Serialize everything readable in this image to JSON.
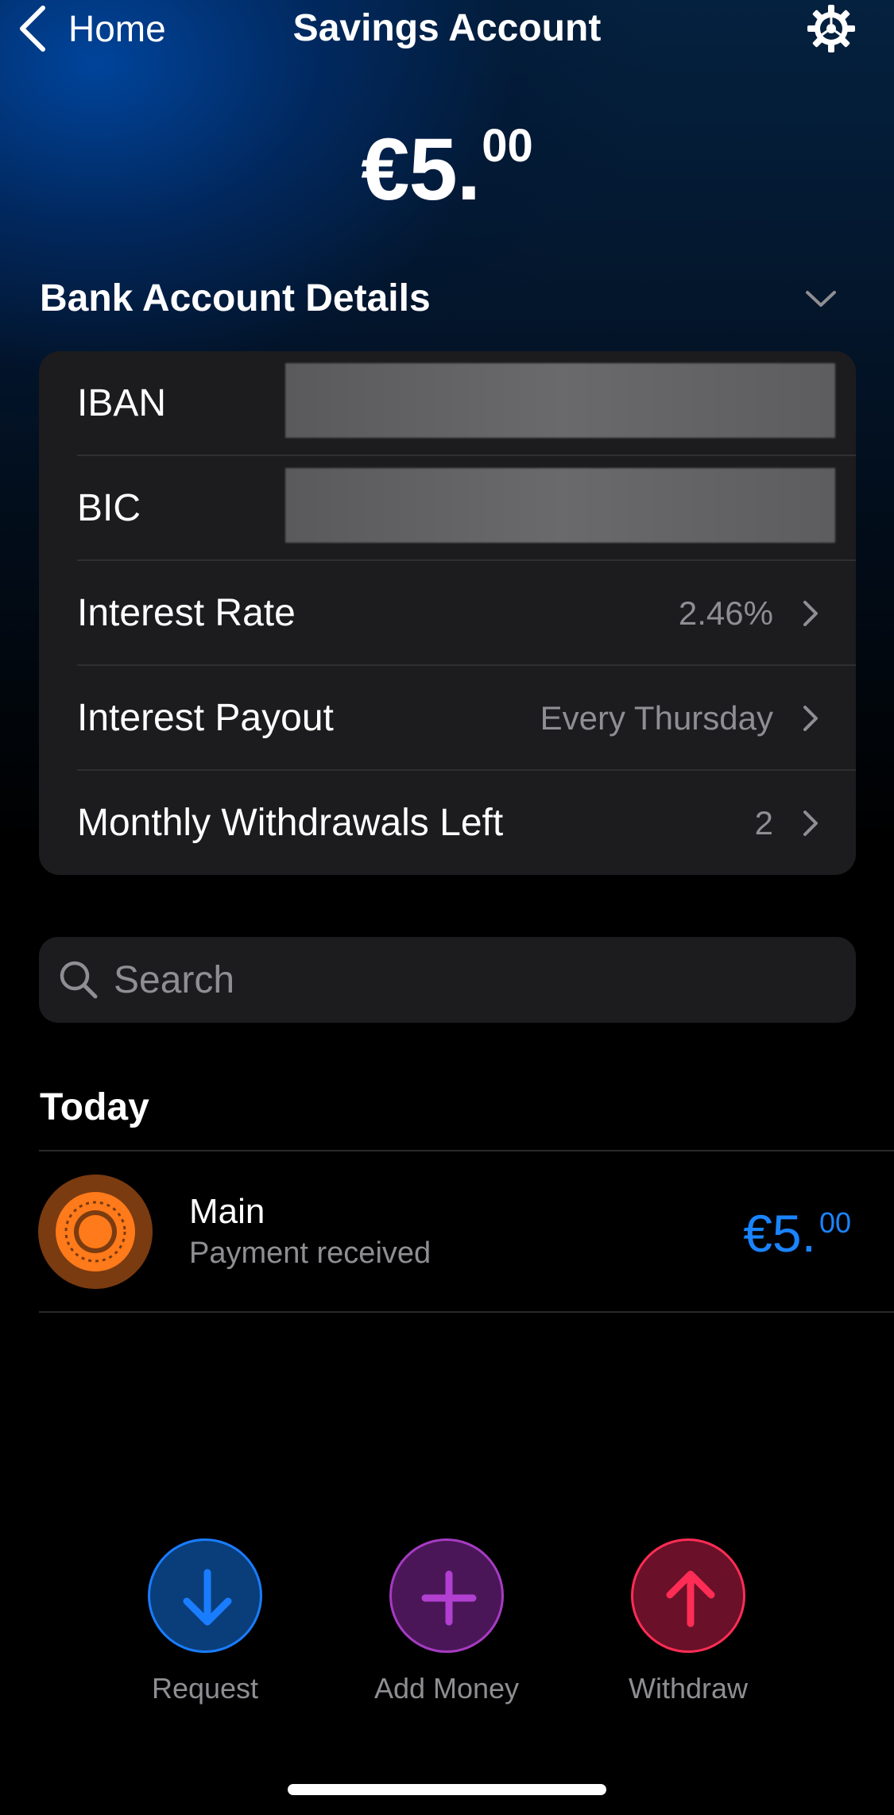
{
  "nav": {
    "back_label": "Home",
    "title": "Savings Account",
    "settings_icon": "gear-icon"
  },
  "balance": {
    "main": "€5.",
    "cents": "00"
  },
  "details": {
    "section_title": "Bank Account Details",
    "rows": [
      {
        "label": "IBAN",
        "value": ""
      },
      {
        "label": "BIC",
        "value": ""
      },
      {
        "label": "Interest Rate",
        "value": "2.46%"
      },
      {
        "label": "Interest Payout",
        "value": "Every Thursday"
      },
      {
        "label": "Monthly Withdrawals Left",
        "value": "2"
      }
    ]
  },
  "search": {
    "placeholder": "Search"
  },
  "transactions": {
    "group_title": "Today",
    "items": [
      {
        "name": "Main",
        "subtitle": "Payment received",
        "amount_main": "€5.",
        "amount_cents": "00"
      }
    ]
  },
  "actions": [
    {
      "label": "Request",
      "icon": "arrow-down-icon",
      "color": "#1a7cff"
    },
    {
      "label": "Add Money",
      "icon": "plus-icon",
      "color": "#a63bc2"
    },
    {
      "label": "Withdraw",
      "icon": "arrow-up-icon",
      "color": "#ff2d55"
    }
  ],
  "colors": {
    "accent_blue": "#1a84ff",
    "card_bg": "#1c1c1e",
    "secondary_text": "#8e8e93"
  }
}
